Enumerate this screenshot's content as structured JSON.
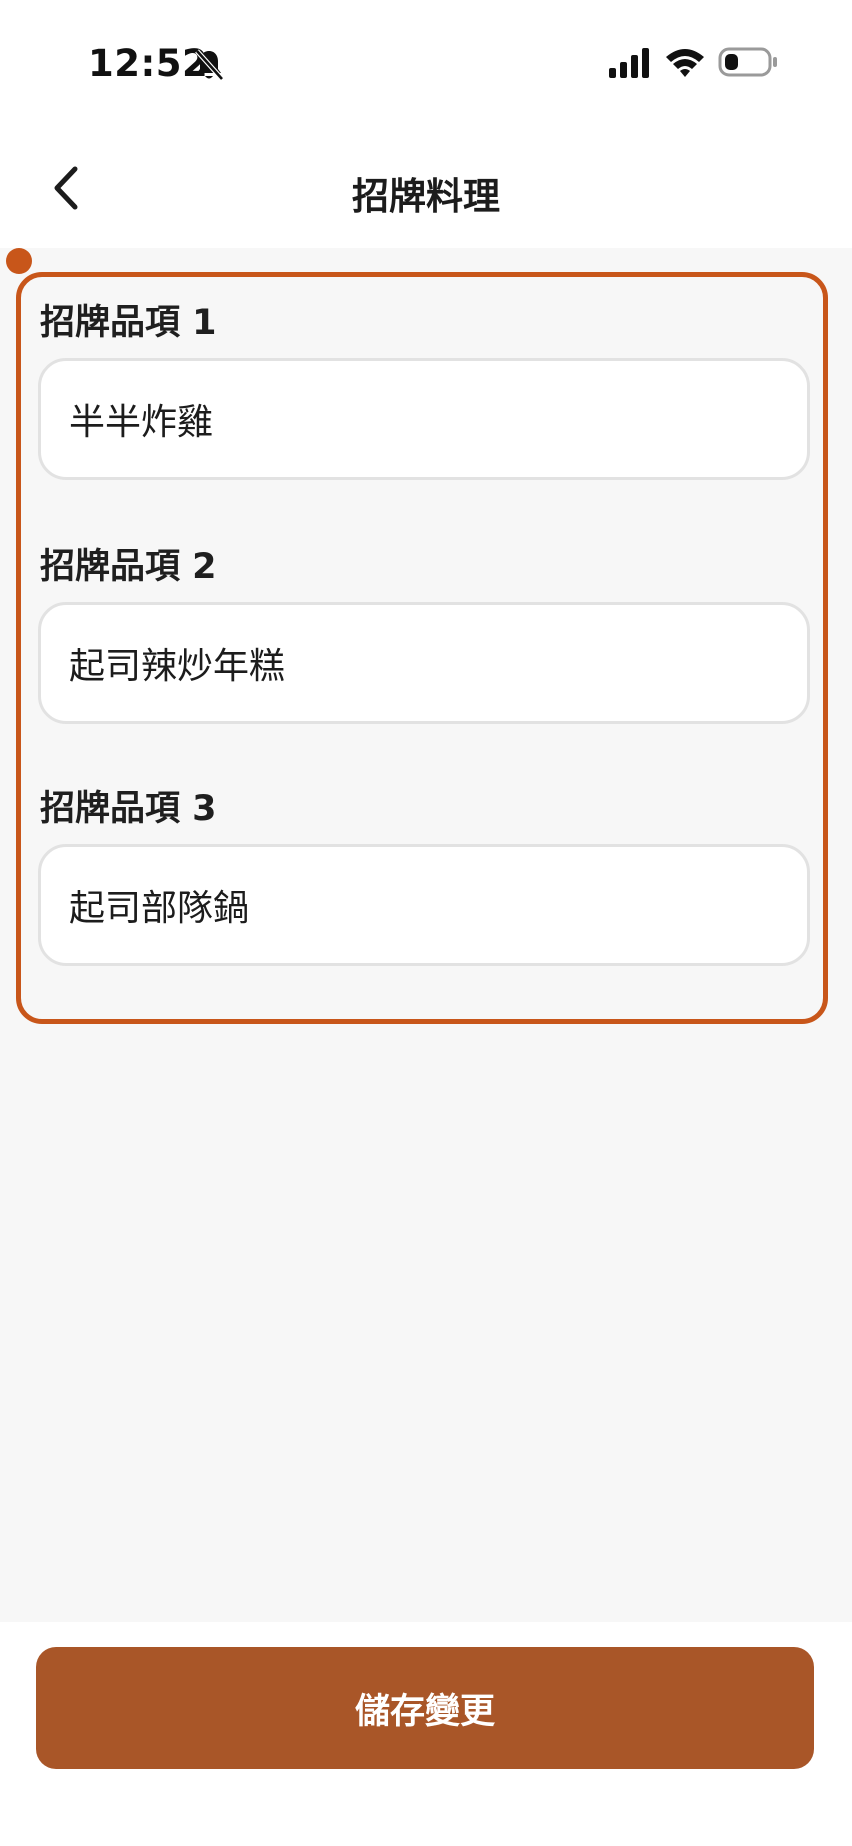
{
  "status_bar": {
    "time": "12:52",
    "icons": [
      "bell-slash-icon",
      "signal-icon",
      "wifi-icon",
      "battery-icon"
    ]
  },
  "nav": {
    "back_icon": "chevron-left-icon",
    "title": "招牌料理"
  },
  "fields": [
    {
      "label": "招牌品項 1",
      "value": "半半炸雞"
    },
    {
      "label": "招牌品項 2",
      "value": "起司辣炒年糕"
    },
    {
      "label": "招牌品項 3",
      "value": "起司部隊鍋"
    }
  ],
  "footer": {
    "save_label": "儲存變更"
  },
  "colors": {
    "accent": "#c8561a",
    "button": "#a95628",
    "background": "#f7f7f7",
    "input_border": "#e2e2e2"
  }
}
